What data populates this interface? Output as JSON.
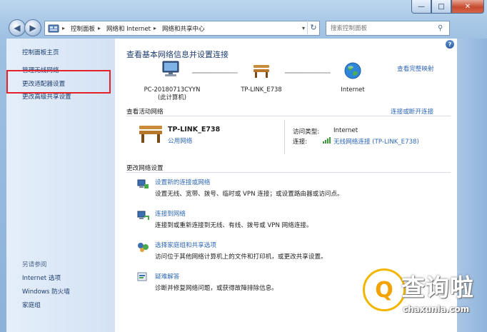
{
  "window": {
    "caption_min": "—",
    "caption_max": "□",
    "caption_close": "✕"
  },
  "navbar": {
    "back": "◀",
    "forward": "▶",
    "breadcrumb": [
      "控制面板",
      "网络和 Internet",
      "网络和共享中心"
    ],
    "separator": "▸",
    "refresh": "↻",
    "search_placeholder": "搜索控制面板"
  },
  "sidebar": {
    "items": [
      {
        "label": "控制面板主页"
      },
      {
        "label": "管理无线网络"
      },
      {
        "label": "更改适配器设置"
      },
      {
        "label": "更改高级共享设置"
      }
    ],
    "see_also_title": "另请参阅",
    "see_also": [
      {
        "label": "Internet 选项"
      },
      {
        "label": "Windows 防火墙"
      },
      {
        "label": "家庭组"
      }
    ]
  },
  "main": {
    "title": "查看基本网络信息并设置连接",
    "full_map": "查看完整映射",
    "map": {
      "computer_name": "PC-20180713CYYN",
      "computer_sub": "(此计算机)",
      "router": "TP-LINK_E738",
      "internet": "Internet"
    },
    "active_section": "查看活动网络",
    "connect_disconnect": "连接或断开连接",
    "active_network": {
      "name": "TP-LINK_E738",
      "type": "公用网络",
      "access_type_label": "访问类型:",
      "access_type_value": "Internet",
      "connection_label": "连接:",
      "connection_value": "无线网络连接 (TP-LINK_E738)"
    },
    "change_section": "更改网络设置",
    "tasks": [
      {
        "link": "设置新的连接或网络",
        "desc": "设置无线、宽带、拨号、临时或 VPN 连接；或设置路由器或访问点。",
        "icon": "new-connection-icon"
      },
      {
        "link": "连接到网络",
        "desc": "连接到或重新连接到无线、有线、拨号或 VPN 网络连接。",
        "icon": "connect-network-icon"
      },
      {
        "link": "选择家庭组和共享选项",
        "desc": "访问位于其他网络计算机上的文件和打印机，或更改共享设置。",
        "icon": "homegroup-icon"
      },
      {
        "link": "疑难解答",
        "desc": "诊断并修复网络问题，或获得故障排除信息。",
        "icon": "troubleshoot-icon"
      }
    ]
  },
  "watermark": {
    "text": "查询啦",
    "url": "chaxunla.com"
  },
  "colors": {
    "link": "#2f68b5",
    "highlight_box": "#e3222a",
    "title": "#1f3e6e"
  }
}
